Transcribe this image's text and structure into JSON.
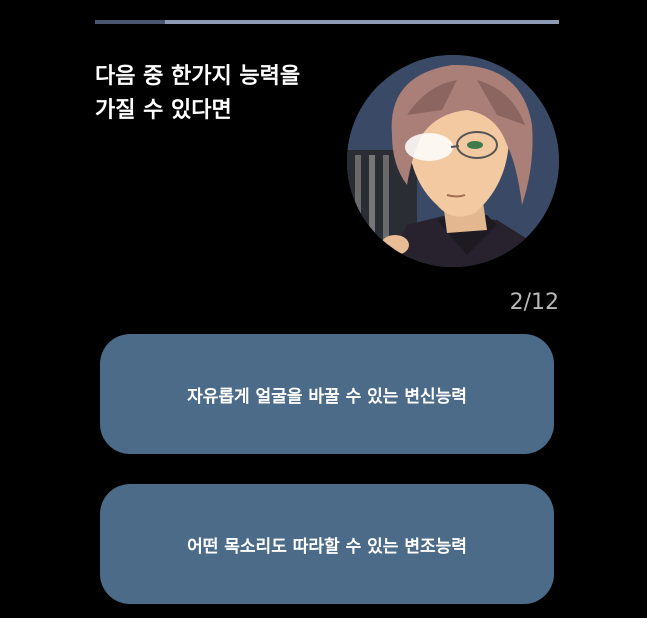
{
  "progress": {
    "current": 2,
    "total": 12,
    "fraction": 0.15
  },
  "question": {
    "line1": "다음 중 한가지 능력을",
    "line2": "가질 수 있다면"
  },
  "counter_text": "2/12",
  "answers": [
    {
      "label": "자유롭게 얼굴을 바꿀 수 있는 변신능력"
    },
    {
      "label": "어떤 목소리도 따라할 수 있는 변조능력"
    }
  ],
  "colors": {
    "background": "#000000",
    "answer_button": "#4b6b88",
    "progress_track": "#8d9ab4",
    "progress_fill": "#4a5670"
  }
}
